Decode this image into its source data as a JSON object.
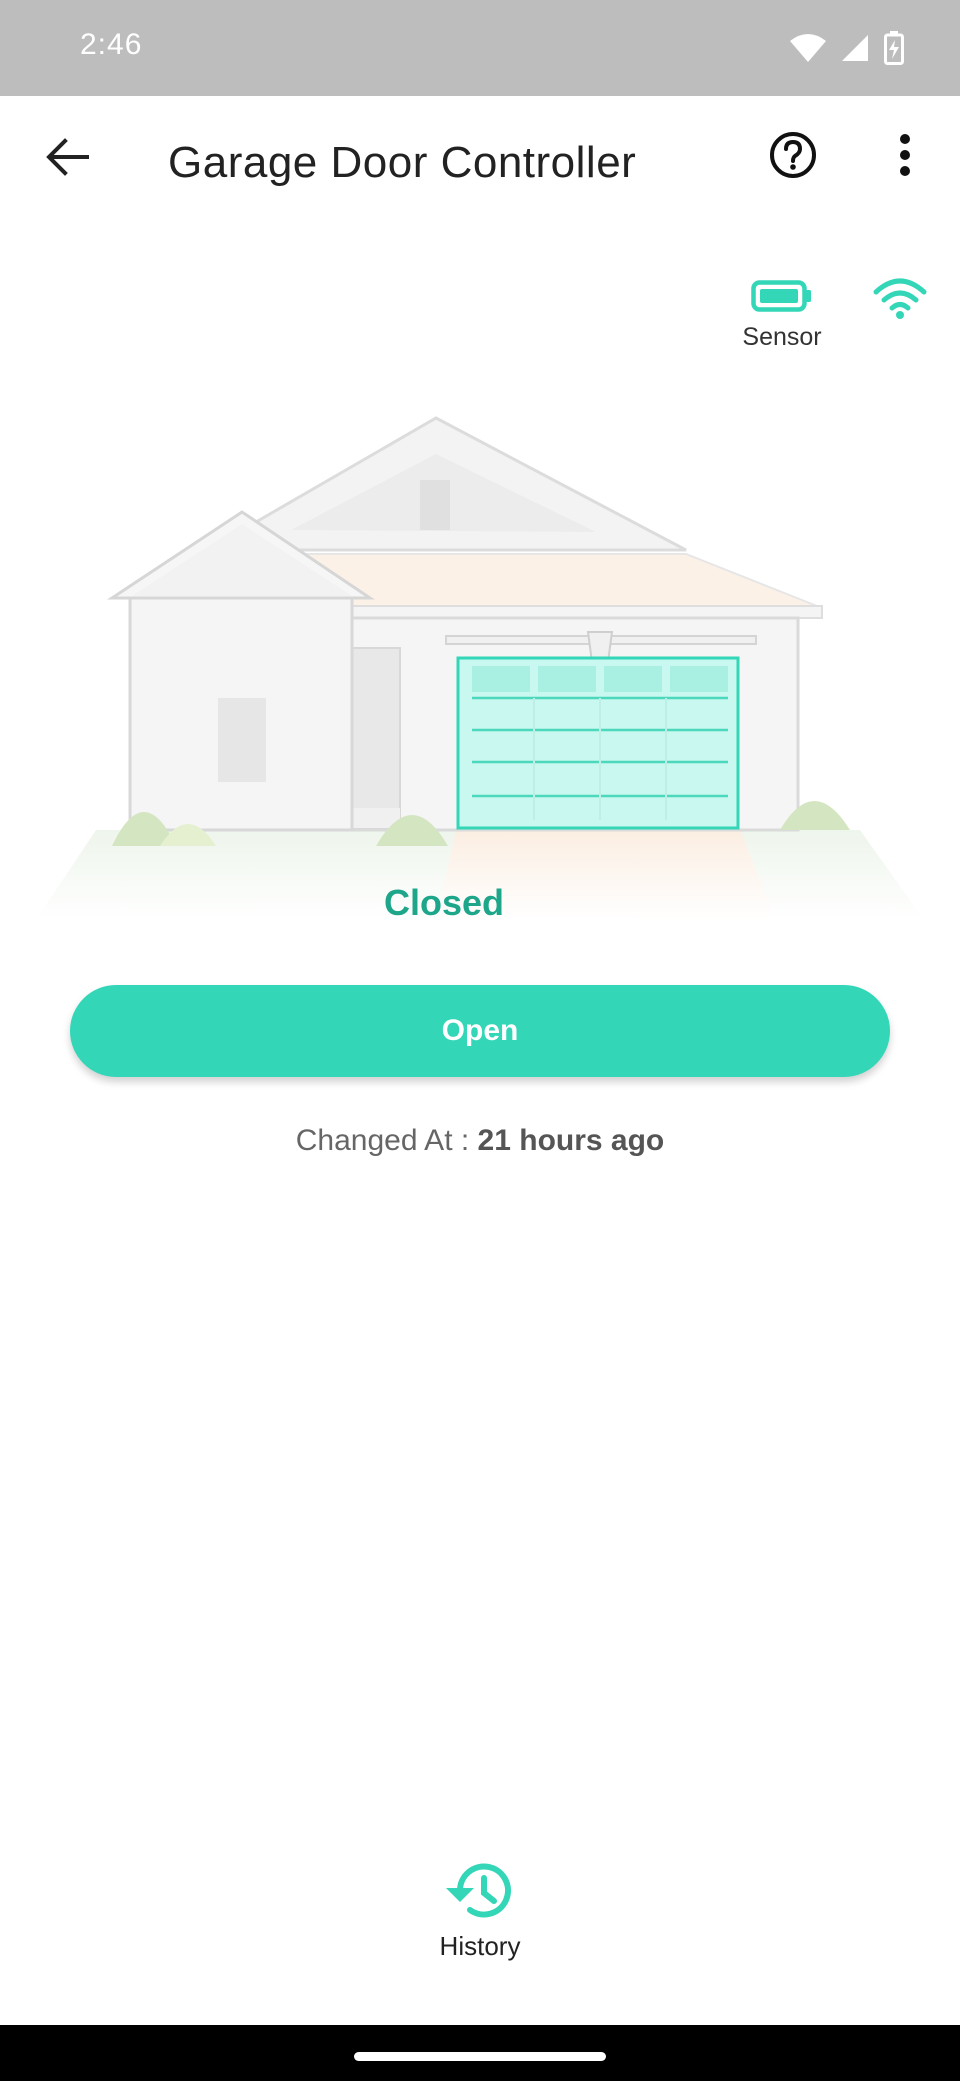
{
  "status_bar": {
    "time": "2:46",
    "icons": [
      "wifi-icon",
      "cellular-signal-icon",
      "battery-charging-icon"
    ]
  },
  "app_bar": {
    "title": "Garage Door Controller",
    "icons": [
      "back-arrow-icon",
      "help-icon",
      "more-vert-icon"
    ]
  },
  "sensor": {
    "label": "Sensor",
    "icons": [
      "battery-icon",
      "wifi-icon"
    ]
  },
  "door": {
    "status": "Closed",
    "action_label": "Open",
    "changed_prefix": "Changed At : ",
    "changed_value": "21 hours ago"
  },
  "bottom_nav": {
    "history_label": "History",
    "icon": "history-icon"
  },
  "colors": {
    "accent": "#33d6b7",
    "status_text": "#1ea68a",
    "status_bar": "#bdbdbd"
  }
}
